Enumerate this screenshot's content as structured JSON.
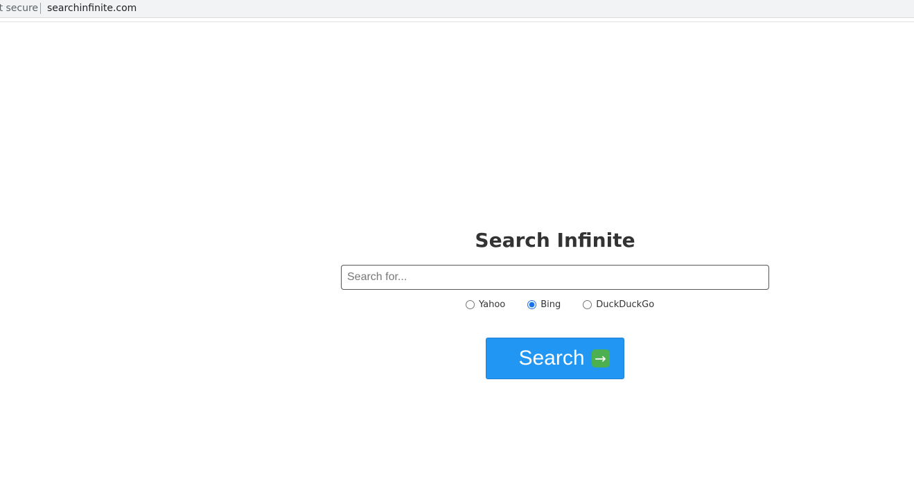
{
  "browser": {
    "security_label": "ot secure",
    "url": "searchinfinite.com"
  },
  "main": {
    "title": "Search Infinite",
    "search": {
      "placeholder": "Search for...",
      "value": ""
    },
    "engines": [
      {
        "label": "Yahoo",
        "checked": false
      },
      {
        "label": "Bing",
        "checked": true
      },
      {
        "label": "DuckDuckGo",
        "checked": false
      }
    ],
    "search_button_label": "Search",
    "search_button_icon": "arrow-right-icon"
  }
}
